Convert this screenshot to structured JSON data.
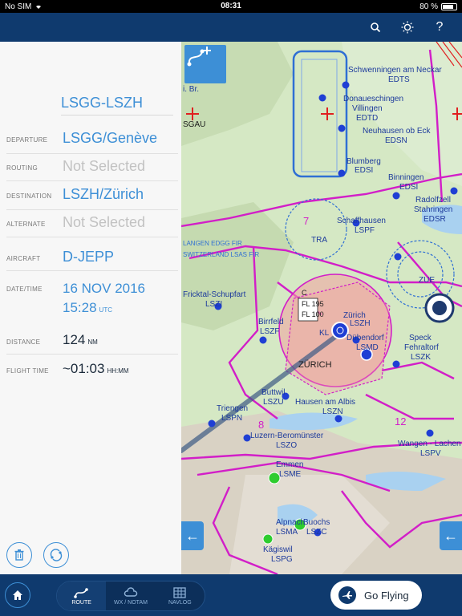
{
  "status_bar": {
    "carrier": "No SIM",
    "time": "08:31",
    "battery": "80 %",
    "battery_level": 0.8
  },
  "toolbar": {
    "search_icon": "search-icon",
    "brightness_icon": "brightness-icon",
    "help_label": "?"
  },
  "route": {
    "title": "LSGG-LSZH",
    "fields": [
      {
        "label": "DEPARTURE",
        "value": "LSGG/Genève"
      },
      {
        "label": "ROUTING",
        "value": "Not Selected"
      },
      {
        "label": "DESTINATION",
        "value": "LSZH/Zürich"
      },
      {
        "label": "ALTERNATE",
        "value": "Not Selected"
      },
      {
        "label": "AIRCRAFT",
        "value": "D-JEPP"
      },
      {
        "label": "DATE/TIME",
        "date": "16 NOV 2016",
        "time": "15:28",
        "time_unit": "UTC"
      },
      {
        "label": "DISTANCE",
        "value": "124",
        "unit": "NM"
      },
      {
        "label": "FLIGHT TIME",
        "value": "~01:03",
        "unit": "HH:MM"
      }
    ]
  },
  "map": {
    "labels": {
      "schwenningen": "Schwenningen am Neckar",
      "edts": "EDTS",
      "donaueschingen": "Donaueschingen",
      "villingen": "Villingen",
      "edtd": "EDTD",
      "neuhausen": "Neuhausen ob Eck",
      "edsn": "EDSN",
      "blumberg": "Blumberg",
      "edsi": "EDSI",
      "binningen": "Binningen",
      "edsi2": "EDSI",
      "radolfzell": "Radolfzell",
      "stahringen": "Stahringen",
      "edsr": "EDSR",
      "schaffhausen": "Schaffhausen",
      "lspf": "LSPF",
      "tra": "TRA",
      "fricktal": "Fricktal-Schupfart",
      "lszi": "LSZI",
      "birrfeld": "Birrfeld",
      "lszf": "LSZF",
      "zurich_ap": "Zürich",
      "lszh": "LSZH",
      "dubendorf": "Dübendorf",
      "lsmd": "LSMD",
      "zurich_city": "ZÜRICH",
      "kl": "KL",
      "speck": "Speck",
      "fehraltorf": "Fehraltorf",
      "lszk": "LSZK",
      "zue": "ZUE",
      "buttwil": "Buttwil",
      "lszu": "LSZU",
      "hausen": "Hausen am Albis",
      "lszn": "LSZN",
      "triengen": "Triengen",
      "lspn": "LSPN",
      "luzern": "Luzern-Beromünster",
      "lszo": "LSZO",
      "wangen": "Wangen - Lachen",
      "lspv": "LSPV",
      "emmen": "Emmen",
      "lsme": "LSME",
      "alpnach": "Alpnach",
      "lsma": "LSMA",
      "buochs": "Buochs",
      "lszc": "LSZC",
      "kagiswil": "Kägiswil",
      "lspg": "LSPG",
      "sgau": "SGAU",
      "ibr": "i. Br.",
      "fl100": "FL 100",
      "fl195": "FL 195",
      "c": "C",
      "fir1": "LANGEN EDGG FIR",
      "fir2": "SWITZERLAND LSAS FIR",
      "n7": "7",
      "n8": "8",
      "n12": "12"
    }
  },
  "bottom_bar": {
    "tabs": [
      {
        "label": "ROUTE"
      },
      {
        "label": "WX / NOTAM"
      },
      {
        "label": "NAVLOG"
      }
    ],
    "go_flying": "Go Flying"
  },
  "colors": {
    "accent": "#3d8fd6",
    "navy": "#0f3a6e",
    "airspace_magenta": "#d21ec8",
    "airspace_blue": "#2f6fd4",
    "ctr_fill": "#f3a0a0"
  }
}
